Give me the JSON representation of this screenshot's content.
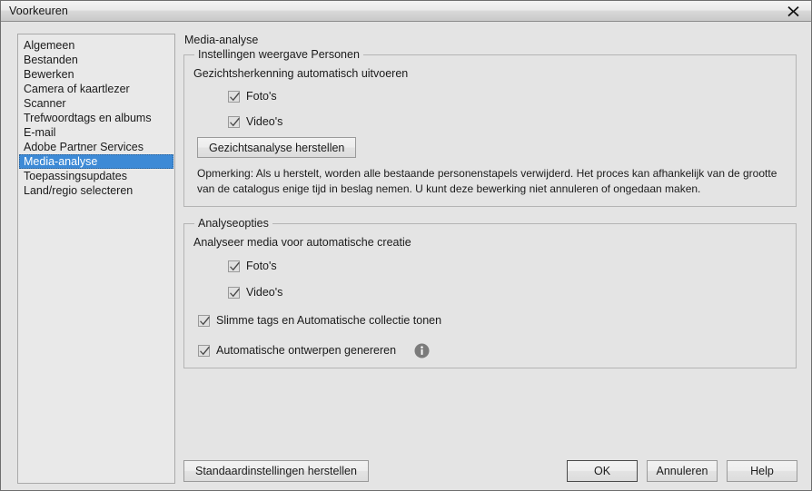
{
  "window": {
    "title": "Voorkeuren",
    "close_icon": "close-icon",
    "accent_selection": "#3d8ad6",
    "background": "#e4e4e4"
  },
  "sidebar": {
    "items": [
      {
        "label": "Algemeen",
        "selected": false
      },
      {
        "label": "Bestanden",
        "selected": false
      },
      {
        "label": "Bewerken",
        "selected": false
      },
      {
        "label": "Camera of kaartlezer",
        "selected": false
      },
      {
        "label": "Scanner",
        "selected": false
      },
      {
        "label": "Trefwoordtags en albums",
        "selected": false
      },
      {
        "label": "E-mail",
        "selected": false
      },
      {
        "label": "Adobe Partner Services",
        "selected": false
      },
      {
        "label": "Media-analyse",
        "selected": true
      },
      {
        "label": "Toepassingsupdates",
        "selected": false
      },
      {
        "label": "Land/regio selecteren",
        "selected": false
      }
    ]
  },
  "pane": {
    "title": "Media-analyse",
    "group_people": {
      "legend": "Instellingen weergave Personen",
      "subtitle": "Gezichtsherkenning automatisch uitvoeren",
      "checkbox_photos": {
        "label": "Foto's",
        "checked": true
      },
      "checkbox_videos": {
        "label": "Video's",
        "checked": true
      },
      "reset_button": "Gezichtsanalyse herstellen",
      "note": "Opmerking: Als u herstelt, worden alle bestaande personenstapels verwijderd. Het proces kan afhankelijk van de grootte van de catalogus enige tijd in beslag nemen. U kunt deze bewerking niet annuleren of ongedaan maken."
    },
    "group_analysis": {
      "legend": "Analyseopties",
      "subtitle": "Analyseer media voor automatische creatie",
      "checkbox_photos": {
        "label": "Foto's",
        "checked": true
      },
      "checkbox_videos": {
        "label": "Video's",
        "checked": true
      },
      "checkbox_smart_tags": {
        "label": "Slimme tags en Automatische collectie tonen",
        "checked": true
      },
      "checkbox_auto_designs": {
        "label": "Automatische ontwerpen genereren",
        "checked": true
      },
      "info_icon": "info-icon"
    }
  },
  "footer": {
    "defaults_button": "Standaardinstellingen herstellen",
    "ok_button": "OK",
    "cancel_button": "Annuleren",
    "help_button": "Help"
  }
}
